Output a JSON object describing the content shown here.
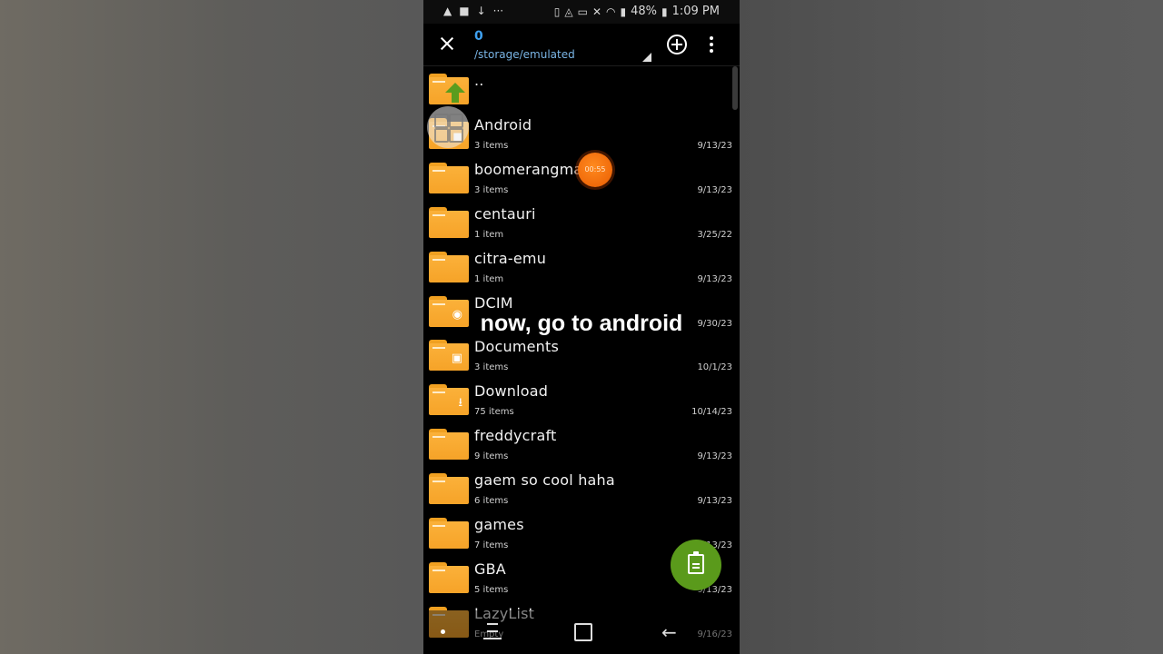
{
  "status_bar": {
    "left_icons": [
      "warning-icon",
      "video-camera-icon",
      "download-icon",
      "more-dots-icon"
    ],
    "right_icons": [
      "nfc-icon",
      "data-saver-icon",
      "cast-icon",
      "mute-icon",
      "wifi-icon",
      "signal-icon"
    ],
    "battery": "48%",
    "time": "1:09 PM"
  },
  "app_bar": {
    "title": "0",
    "path": "/storage/emulated"
  },
  "files": [
    {
      "name": "..",
      "items": "",
      "date": "",
      "icon": "up-folder"
    },
    {
      "name": "Android",
      "items": "3 items",
      "date": "9/13/23",
      "icon": "folder-android"
    },
    {
      "name": "boomerangman",
      "items": "3 items",
      "date": "9/13/23",
      "icon": "folder"
    },
    {
      "name": "centauri",
      "items": "1 item",
      "date": "3/25/22",
      "icon": "folder"
    },
    {
      "name": "citra-emu",
      "items": "1 item",
      "date": "9/13/23",
      "icon": "folder"
    },
    {
      "name": "DCIM",
      "items": "",
      "date": "9/30/23",
      "icon": "folder-camera"
    },
    {
      "name": "Documents",
      "items": "3 items",
      "date": "10/1/23",
      "icon": "folder-briefcase"
    },
    {
      "name": "Download",
      "items": "75 items",
      "date": "10/14/23",
      "icon": "folder-download"
    },
    {
      "name": "freddycraft",
      "items": "9 items",
      "date": "9/13/23",
      "icon": "folder"
    },
    {
      "name": "gaem so cool haha",
      "items": "6 items",
      "date": "9/13/23",
      "icon": "folder"
    },
    {
      "name": "games",
      "items": "7 items",
      "date": "9/13/23",
      "icon": "folder"
    },
    {
      "name": "GBA",
      "items": "5 items",
      "date": "9/13/23",
      "icon": "folder"
    },
    {
      "name": "LazyList",
      "items": "Empty",
      "date": "9/16/23",
      "icon": "folder"
    }
  ],
  "overlay": {
    "caption": "now, go to android",
    "recording_timer": "00:55"
  },
  "colors": {
    "folder": "#f6a328",
    "accent_blue": "#3fa0f0",
    "fab_green": "#5a9a1b",
    "record_orange": "#f06a0a"
  }
}
